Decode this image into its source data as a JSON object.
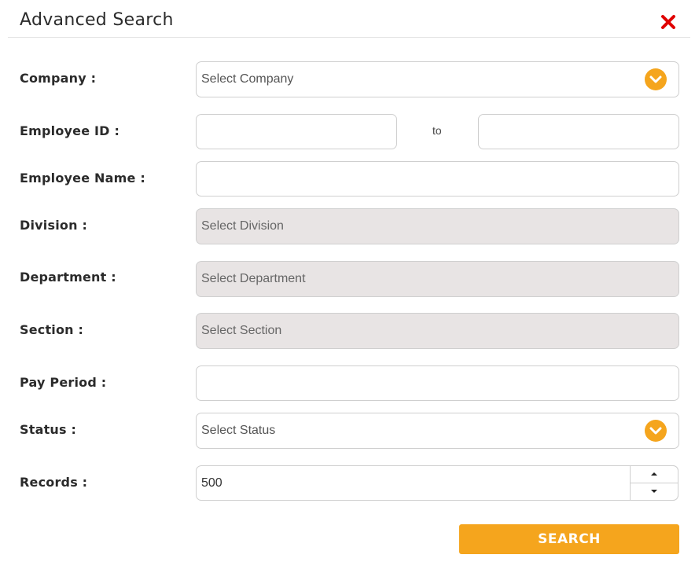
{
  "dialog": {
    "title": "Advanced Search",
    "close_icon": "close-icon",
    "accent_color": "#F5A51D",
    "close_color": "#E00000"
  },
  "form": {
    "company": {
      "label": "Company :",
      "placeholder": "Select Company"
    },
    "employee_id": {
      "label": "Employee ID :",
      "from_value": "",
      "separator": "to",
      "to_value": ""
    },
    "employee_name": {
      "label": "Employee Name :",
      "value": ""
    },
    "division": {
      "label": "Division :",
      "placeholder": "Select Division"
    },
    "department": {
      "label": "Department :",
      "placeholder": "Select Department"
    },
    "section": {
      "label": "Section :",
      "placeholder": "Select Section"
    },
    "pay_period": {
      "label": "Pay Period :",
      "value": ""
    },
    "status": {
      "label": "Status :",
      "placeholder": "Select Status"
    },
    "records": {
      "label": "Records :",
      "value": "500"
    }
  },
  "actions": {
    "search_label": "SEARCH"
  }
}
